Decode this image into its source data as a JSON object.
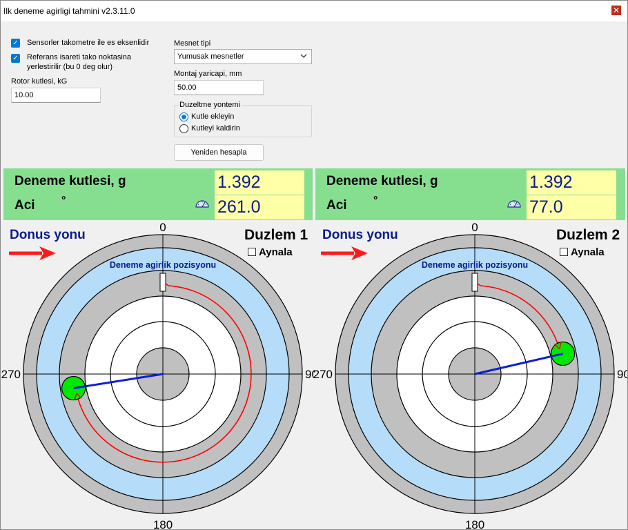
{
  "window": {
    "title": "Ilk deneme agirligi tahmini v2.3.11.0",
    "close_glyph": "✕"
  },
  "settings": {
    "cb1_label": "Sensorler takometre ile es eksenlidir",
    "cb2_label_line1": "Referans isareti tako noktasina",
    "cb2_label_line2": "yerlestirilir (bu 0 deg olur)",
    "rotor_mass_label": "Rotor kutlesi, kG",
    "rotor_mass_value": "10.00",
    "support_type_label": "Mesnet tipi",
    "support_type_value": "Yumusak mesnetler",
    "mount_radius_label": "Montaj yaricapi, mm",
    "mount_radius_value": "50.00",
    "correction_group_label": "Duzeltme yontemi",
    "radio_add_label": "Kutle ekleyin",
    "radio_remove_label": "Kutleyi kaldirin",
    "recalc_label": "Yeniden hesapla"
  },
  "plane1": {
    "mass_label": "Deneme kutlesi, g",
    "angle_label": "Aci",
    "degree_symbol": "°",
    "mass_value": "1.392",
    "angle_value": "261.0",
    "rotation_label": "Donus yonu",
    "title": "Duzlem 1",
    "mirror_label": "Aynala",
    "position_label": "Deneme agirlik pozisyonu",
    "axis_top": "0",
    "axis_right": "90",
    "axis_bottom": "180",
    "axis_left": "270",
    "angle_deg": 261.0
  },
  "plane2": {
    "mass_label": "Deneme kutlesi, g",
    "angle_label": "Aci",
    "degree_symbol": "°",
    "mass_value": "1.392",
    "angle_value": "77.0",
    "rotation_label": "Donus yonu",
    "title": "Duzlem 2",
    "mirror_label": "Aynala",
    "position_label": "Deneme agirlik pozisyonu",
    "axis_top": "0",
    "axis_right": "90",
    "axis_bottom": "180",
    "axis_left": "270",
    "angle_deg": 77.0
  },
  "colors": {
    "panel_green": "#86df8f",
    "value_yellow": "#ffffa8",
    "value_text": "#0a1b8c",
    "ring_gray": "#c0c0c0",
    "ring_blue": "#b5dcf8",
    "weight_green": "#00e800",
    "vector_blue": "#0a1fd6",
    "arc_red": "#ff0000"
  }
}
